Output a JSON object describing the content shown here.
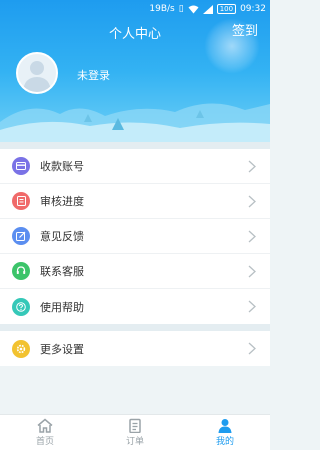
{
  "status_bar": {
    "speed": "19B/s",
    "battery": "100",
    "time": "09:32"
  },
  "header": {
    "title": "个人中心",
    "sign_in": "签到",
    "user_status": "未登录"
  },
  "menu": {
    "items": [
      {
        "label": "收款账号",
        "icon": "card-icon",
        "color": "#7a72e6"
      },
      {
        "label": "审核进度",
        "icon": "document-icon",
        "color": "#f06a6a"
      },
      {
        "label": "意见反馈",
        "icon": "edit-icon",
        "color": "#5b8ef0"
      },
      {
        "label": "联系客服",
        "icon": "headset-icon",
        "color": "#3cc46a"
      },
      {
        "label": "使用帮助",
        "icon": "question-icon",
        "color": "#35c8b8"
      },
      {
        "label": "更多设置",
        "icon": "gear-icon",
        "color": "#f2c230"
      }
    ]
  },
  "bottom_nav": {
    "items": [
      {
        "label": "首页",
        "icon": "home-icon",
        "active": false
      },
      {
        "label": "订单",
        "icon": "clipboard-icon",
        "active": false
      },
      {
        "label": "我的",
        "icon": "user-icon",
        "active": true
      }
    ]
  },
  "colors": {
    "accent": "#1e9cef",
    "inactive": "#9aa3a8"
  }
}
